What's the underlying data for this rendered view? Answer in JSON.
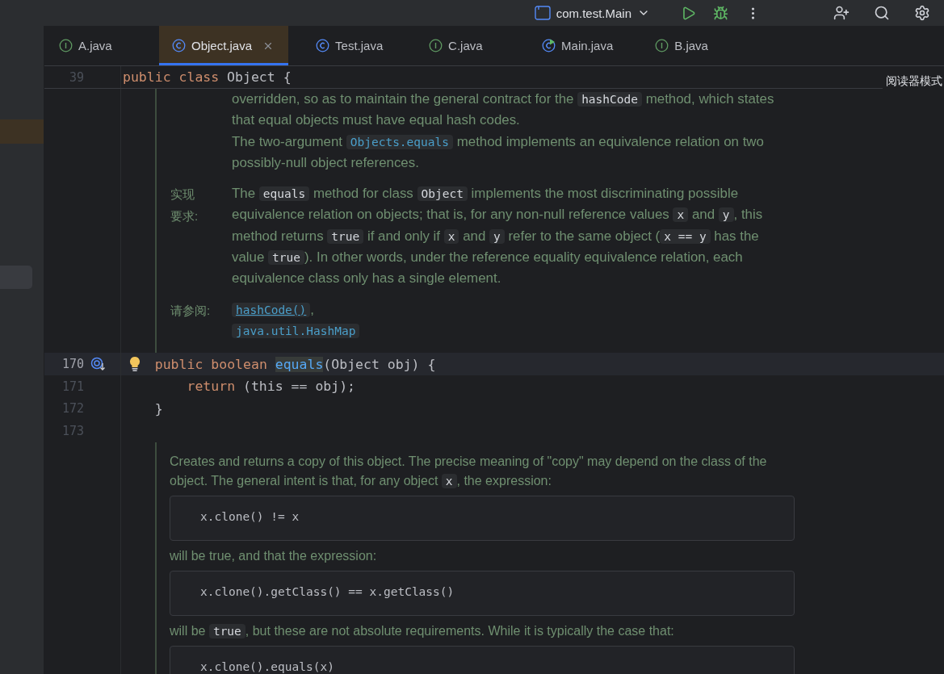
{
  "toolbar": {
    "run_configuration": "com.test.Main"
  },
  "tabs": [
    {
      "label": "A.java",
      "kind": "interface",
      "selected": false,
      "closable": false
    },
    {
      "label": "Object.java",
      "kind": "class",
      "selected": true,
      "closable": true
    },
    {
      "label": "Test.java",
      "kind": "class",
      "selected": false,
      "closable": false
    },
    {
      "label": "C.java",
      "kind": "interface",
      "selected": false,
      "closable": false
    },
    {
      "label": "Main.java",
      "kind": "runnable",
      "selected": false,
      "closable": false
    },
    {
      "label": "B.java",
      "kind": "interface",
      "selected": false,
      "closable": false
    }
  ],
  "sticky_line": {
    "number": "39",
    "tokens": [
      {
        "kind": "keyword",
        "text": "public class"
      },
      {
        "kind": "plain",
        "text": "Object {"
      }
    ]
  },
  "reader_mode": "阅读器模式",
  "editor": [
    {
      "kind": "doc",
      "sections": [
        {
          "items": [
            {
              "kind": "paragraph",
              "segments": [
                {
                  "kind": "text",
                  "text": "overridden, so as to maintain the general contract for the "
                },
                {
                  "kind": "code",
                  "text": "hashCode"
                },
                {
                  "kind": "text",
                  "text": " method, which states that equal objects must have equal hash codes."
                }
              ]
            },
            {
              "kind": "paragraph",
              "segments": [
                {
                  "kind": "text",
                  "text": "The two-argument "
                },
                {
                  "kind": "link",
                  "text": "Objects.equals",
                  "underlined": false
                },
                {
                  "kind": "text",
                  "text": " method implements an equivalence relation on two possibly-null object references."
                }
              ]
            }
          ]
        },
        {
          "label": [
            "实现",
            "要求:"
          ],
          "items": [
            {
              "kind": "paragraph",
              "segments": [
                {
                  "kind": "text",
                  "text": "The "
                },
                {
                  "kind": "code",
                  "text": "equals"
                },
                {
                  "kind": "text",
                  "text": " method for class "
                },
                {
                  "kind": "code",
                  "text": "Object"
                },
                {
                  "kind": "text",
                  "text": " implements the most discriminating possible equivalence relation on objects; that is, for any non-null reference values "
                },
                {
                  "kind": "code",
                  "text": "x"
                },
                {
                  "kind": "text",
                  "text": " and "
                },
                {
                  "kind": "code",
                  "text": "y"
                },
                {
                  "kind": "text",
                  "text": ", this method returns "
                },
                {
                  "kind": "code",
                  "text": "true"
                },
                {
                  "kind": "text",
                  "text": " if and only if "
                },
                {
                  "kind": "code",
                  "text": "x"
                },
                {
                  "kind": "text",
                  "text": " and "
                },
                {
                  "kind": "code",
                  "text": "y"
                },
                {
                  "kind": "text",
                  "text": " refer to the same object ("
                },
                {
                  "kind": "code",
                  "text": "x == y"
                },
                {
                  "kind": "text",
                  "text": " has the value "
                },
                {
                  "kind": "code",
                  "text": "true"
                },
                {
                  "kind": "text",
                  "text": "). In other words, under the reference equality equivalence relation, each equivalence class only has a single element."
                }
              ]
            }
          ]
        },
        {
          "label": [
            "请参阅:"
          ],
          "items": [
            {
              "kind": "paragraph",
              "segments": [
                {
                  "kind": "link",
                  "text": "hashCode()",
                  "underlined": true
                },
                {
                  "kind": "text",
                  "text": ","
                }
              ]
            },
            {
              "kind": "paragraph",
              "segments": [
                {
                  "kind": "link",
                  "text": "java.util.HashMap",
                  "underlined": false
                }
              ]
            }
          ]
        }
      ]
    },
    {
      "kind": "code",
      "number": "170",
      "current": true,
      "overrides": true,
      "intention": true,
      "tokens": [
        {
          "kind": "keyword",
          "text": "    public boolean"
        },
        {
          "kind": "declaration",
          "text": "equals",
          "highlighted": true
        },
        {
          "kind": "plain",
          "text": "(Object obj) {"
        }
      ]
    },
    {
      "kind": "code",
      "number": "171",
      "current": false,
      "tokens": [
        {
          "kind": "keyword",
          "text": "        return"
        },
        {
          "kind": "plain",
          "text": "(this == obj);"
        }
      ]
    },
    {
      "kind": "code",
      "number": "172",
      "current": false,
      "tokens": [
        {
          "kind": "plain",
          "text": "    }"
        }
      ]
    },
    {
      "kind": "code",
      "number": "173",
      "current": false
    },
    {
      "kind": "doc",
      "sections": [
        {
          "items": [
            {
              "kind": "paragraph",
              "segments": [
                {
                  "kind": "text",
                  "text": "Creates and returns a copy of this object. The precise meaning of \"copy\" may depend on the class of the object. The general intent is that, for any object "
                },
                {
                  "kind": "code",
                  "text": "x"
                },
                {
                  "kind": "text",
                  "text": ", the expression:"
                }
              ]
            },
            {
              "kind": "codeblock",
              "text": "x.clone() != x"
            },
            {
              "kind": "paragraph",
              "segments": [
                {
                  "kind": "text",
                  "text": "will be true, and that the expression:"
                }
              ]
            },
            {
              "kind": "codeblock",
              "text": "x.clone().getClass() == x.getClass()"
            },
            {
              "kind": "paragraph",
              "segments": [
                {
                  "kind": "text",
                  "text": "will be "
                },
                {
                  "kind": "code",
                  "text": "true"
                },
                {
                  "kind": "text",
                  "text": ", but these are not absolute requirements. While it is typically the case that:"
                }
              ]
            },
            {
              "kind": "codeblock",
              "text": "x.clone().equals(x)"
            }
          ]
        }
      ]
    }
  ]
}
